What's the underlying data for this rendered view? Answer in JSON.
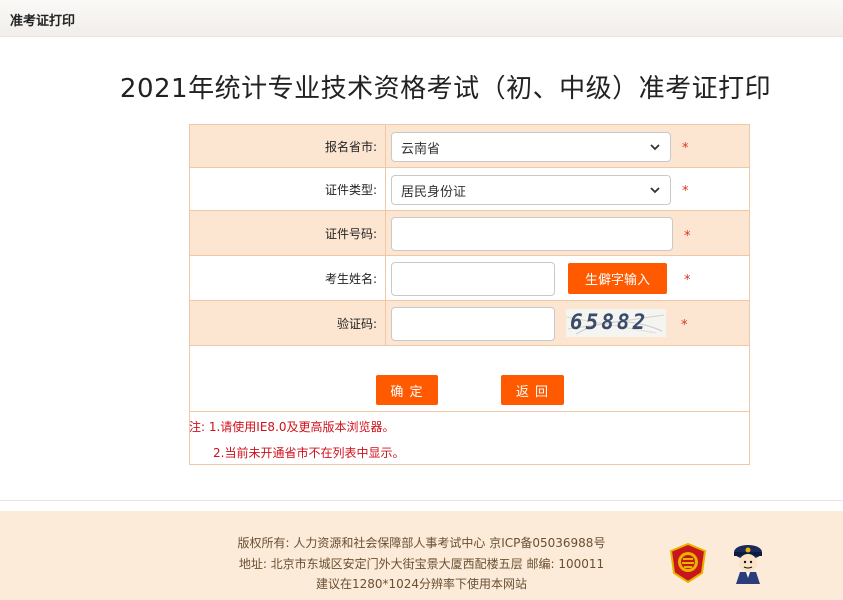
{
  "header": {
    "title": "准考证打印"
  },
  "page_title": "2021年统计专业技术资格考试（初、中级）准考证打印",
  "form": {
    "province": {
      "label": "报名省市:",
      "value": "云南省"
    },
    "id_type": {
      "label": "证件类型:",
      "value": "居民身份证"
    },
    "id_number": {
      "label": "证件号码:",
      "value": ""
    },
    "name": {
      "label": "考生姓名:",
      "value": "",
      "rare_char_button": "生僻字输入"
    },
    "captcha": {
      "label": "验证码:",
      "value": "",
      "image_text": "65882"
    },
    "required_mark": "*"
  },
  "actions": {
    "confirm_label": "确 定",
    "back_label": "返 回"
  },
  "notes": [
    "注: 1.请使用IE8.0及更高版本浏览器。",
    "2.当前未开通省市不在列表中显示。"
  ],
  "footer": {
    "line1": "版权所有: 人力资源和社会保障部人事考试中心 京ICP备05036988号",
    "line2": "地址: 北京市东城区安定门外大街宝景大厦西配楼五层 邮编: 100011",
    "line3": "建议在1280*1024分辨率下使用本网站"
  },
  "colors": {
    "accent": "#ff5a00",
    "row_tan": "#fce6d2",
    "required": "#e0301e",
    "note": "#d0101a"
  },
  "icons": [
    "chevron-down-icon",
    "gongan-emblem-icon",
    "police-mascot-icon"
  ]
}
